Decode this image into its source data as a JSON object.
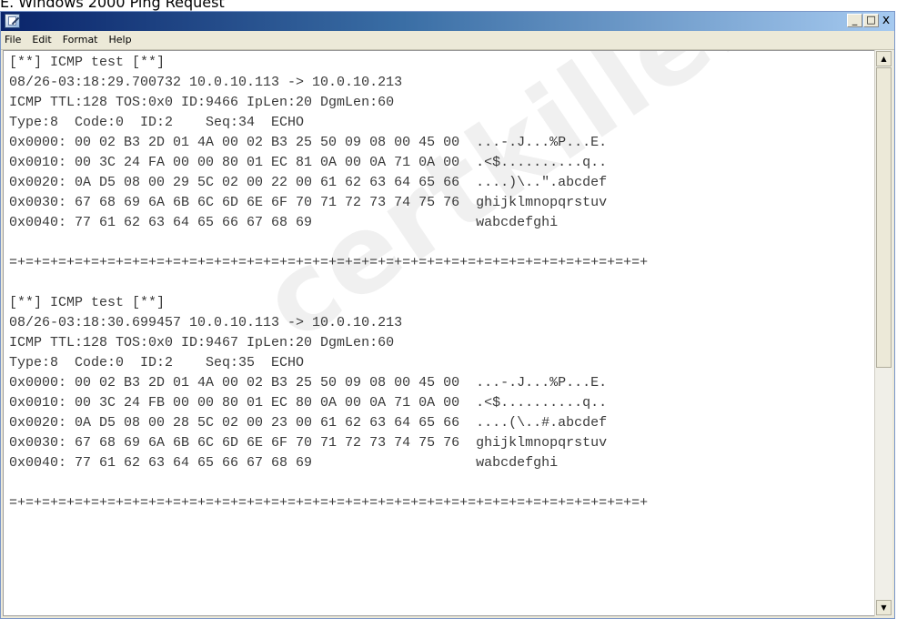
{
  "page_caption": "E. Windows 2000 Ping Request",
  "window": {
    "icon": "notepad-icon",
    "controls": {
      "minimize": "_",
      "maximize": "□",
      "close": "x"
    }
  },
  "menu": {
    "items": [
      {
        "label": "File"
      },
      {
        "label": "Edit"
      },
      {
        "label": "Format"
      },
      {
        "label": "Help"
      }
    ]
  },
  "document": {
    "lines": [
      "[**] ICMP test [**]",
      "08/26-03:18:29.700732 10.0.10.113 -> 10.0.10.213",
      "ICMP TTL:128 TOS:0x0 ID:9466 IpLen:20 DgmLen:60",
      "Type:8  Code:0  ID:2    Seq:34  ECHO",
      "0x0000: 00 02 B3 2D 01 4A 00 02 B3 25 50 09 08 00 45 00  ...-.J...%P...E.",
      "0x0010: 00 3C 24 FA 00 00 80 01 EC 81 0A 00 0A 71 0A 00  .<$..........q..",
      "0x0020: 0A D5 08 00 29 5C 02 00 22 00 61 62 63 64 65 66  ....)\\..\".abcdef",
      "0x0030: 67 68 69 6A 6B 6C 6D 6E 6F 70 71 72 73 74 75 76  ghijklmnopqrstuv",
      "0x0040: 77 61 62 63 64 65 66 67 68 69                    wabcdefghi",
      "",
      "=+=+=+=+=+=+=+=+=+=+=+=+=+=+=+=+=+=+=+=+=+=+=+=+=+=+=+=+=+=+=+=+=+=+=+=+=+=+=+",
      "",
      "[**] ICMP test [**]",
      "08/26-03:18:30.699457 10.0.10.113 -> 10.0.10.213",
      "ICMP TTL:128 TOS:0x0 ID:9467 IpLen:20 DgmLen:60",
      "Type:8  Code:0  ID:2    Seq:35  ECHO",
      "0x0000: 00 02 B3 2D 01 4A 00 02 B3 25 50 09 08 00 45 00  ...-.J...%P...E.",
      "0x0010: 00 3C 24 FB 00 00 80 01 EC 80 0A 00 0A 71 0A 00  .<$..........q..",
      "0x0020: 0A D5 08 00 28 5C 02 00 23 00 61 62 63 64 65 66  ....(\\..#.abcdef",
      "0x0030: 67 68 69 6A 6B 6C 6D 6E 6F 70 71 72 73 74 75 76  ghijklmnopqrstuv",
      "0x0040: 77 61 62 63 64 65 66 67 68 69                    wabcdefghi",
      "",
      "=+=+=+=+=+=+=+=+=+=+=+=+=+=+=+=+=+=+=+=+=+=+=+=+=+=+=+=+=+=+=+=+=+=+=+=+=+=+=+"
    ]
  },
  "watermark": "certkillers.net",
  "colors": {
    "titlebar_start": "#0a246a",
    "titlebar_end": "#a6caf0",
    "chrome": "#ece9d8",
    "text": "#3a3a3a"
  }
}
